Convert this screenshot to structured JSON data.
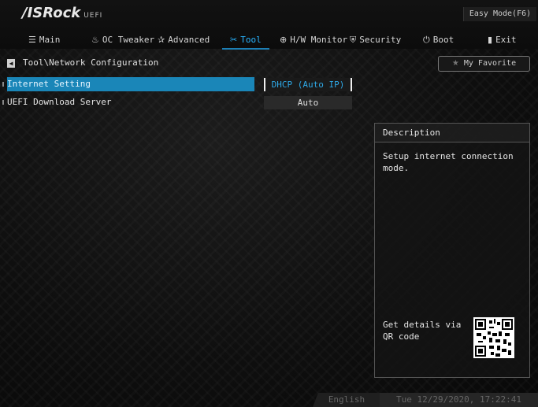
{
  "header": {
    "brand": "/ISRock",
    "brand_suffix": "UEFI",
    "easy_mode": "Easy Mode(F6)"
  },
  "menu": [
    {
      "icon": "list-icon",
      "glyph": "☰",
      "label": "Main"
    },
    {
      "icon": "flame-icon",
      "glyph": "♨",
      "label": "OC Tweaker"
    },
    {
      "icon": "star-icon",
      "glyph": "✰",
      "label": "Advanced"
    },
    {
      "icon": "tools-icon",
      "glyph": "✂",
      "label": "Tool",
      "active": true
    },
    {
      "icon": "monitor-icon",
      "glyph": "⊕",
      "label": "H/W Monitor"
    },
    {
      "icon": "shield-icon",
      "glyph": "⛨",
      "label": "Security"
    },
    {
      "icon": "power-icon",
      "glyph": "⏻",
      "label": "Boot"
    },
    {
      "icon": "exit-icon",
      "glyph": "▮",
      "label": "Exit"
    }
  ],
  "breadcrumb": {
    "back_glyph": "◀",
    "path": "Tool\\Network Configuration"
  },
  "favorite": {
    "star": "★",
    "label": "My Favorite"
  },
  "settings": [
    {
      "label": "Internet Setting",
      "value": "DHCP (Auto IP)",
      "selected": true
    },
    {
      "label": "UEFI Download Server",
      "value": "Auto",
      "selected": false
    }
  ],
  "description": {
    "title": "Description",
    "text": "Setup internet connection mode.",
    "qr_text": "Get details via QR code"
  },
  "footer": {
    "language": "English",
    "datetime": "Tue 12/29/2020, 17:22:41"
  },
  "colors": {
    "accent": "#1a86b8",
    "active_tab": "#29b4ff",
    "background": "#0b0b0b"
  }
}
